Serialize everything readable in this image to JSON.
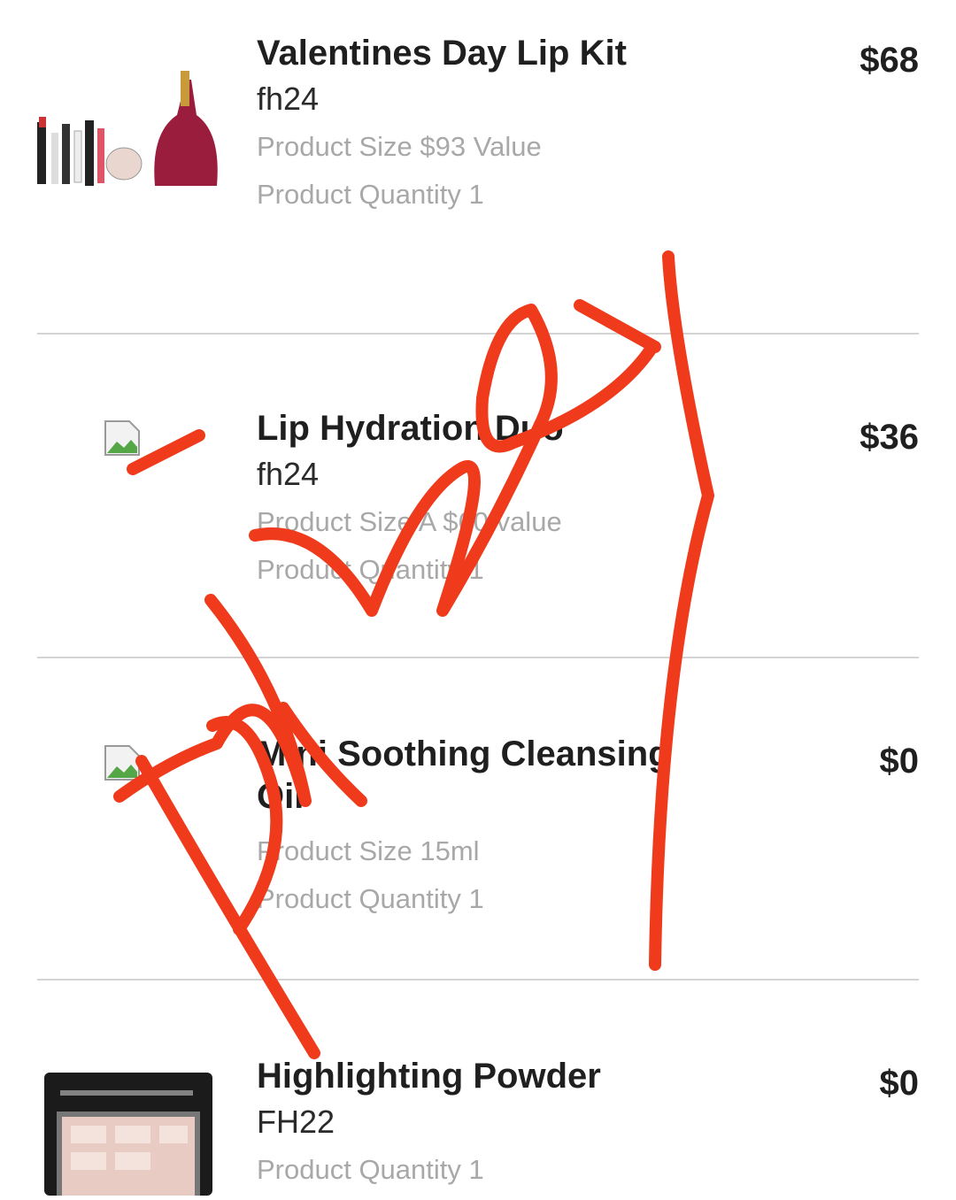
{
  "items": [
    {
      "name": "Valentines Day Lip Kit",
      "code": "fh24",
      "size": "Product Size $93 Value",
      "quantity": "Product Quantity 1",
      "price": "$68"
    },
    {
      "name": "Lip Hydration Duo",
      "code": "fh24",
      "size": "Product Size A $60 value",
      "quantity": "Product Quantity 1",
      "price": "$36"
    },
    {
      "name": "Mini Soothing Cleansing Oil",
      "size": "Product Size 15ml",
      "quantity": "Product Quantity 1",
      "price": "$0"
    },
    {
      "name": "Highlighting Powder",
      "code": "FH22",
      "quantity": "Product Quantity 1",
      "price": "$0"
    }
  ],
  "colors": {
    "annotation": "#f03a1c",
    "title_text": "#1f1f1f",
    "meta_text": "#a8a8a8",
    "divider": "#d4d4d4"
  },
  "icons": [
    "broken-image-icon",
    "product-image"
  ]
}
